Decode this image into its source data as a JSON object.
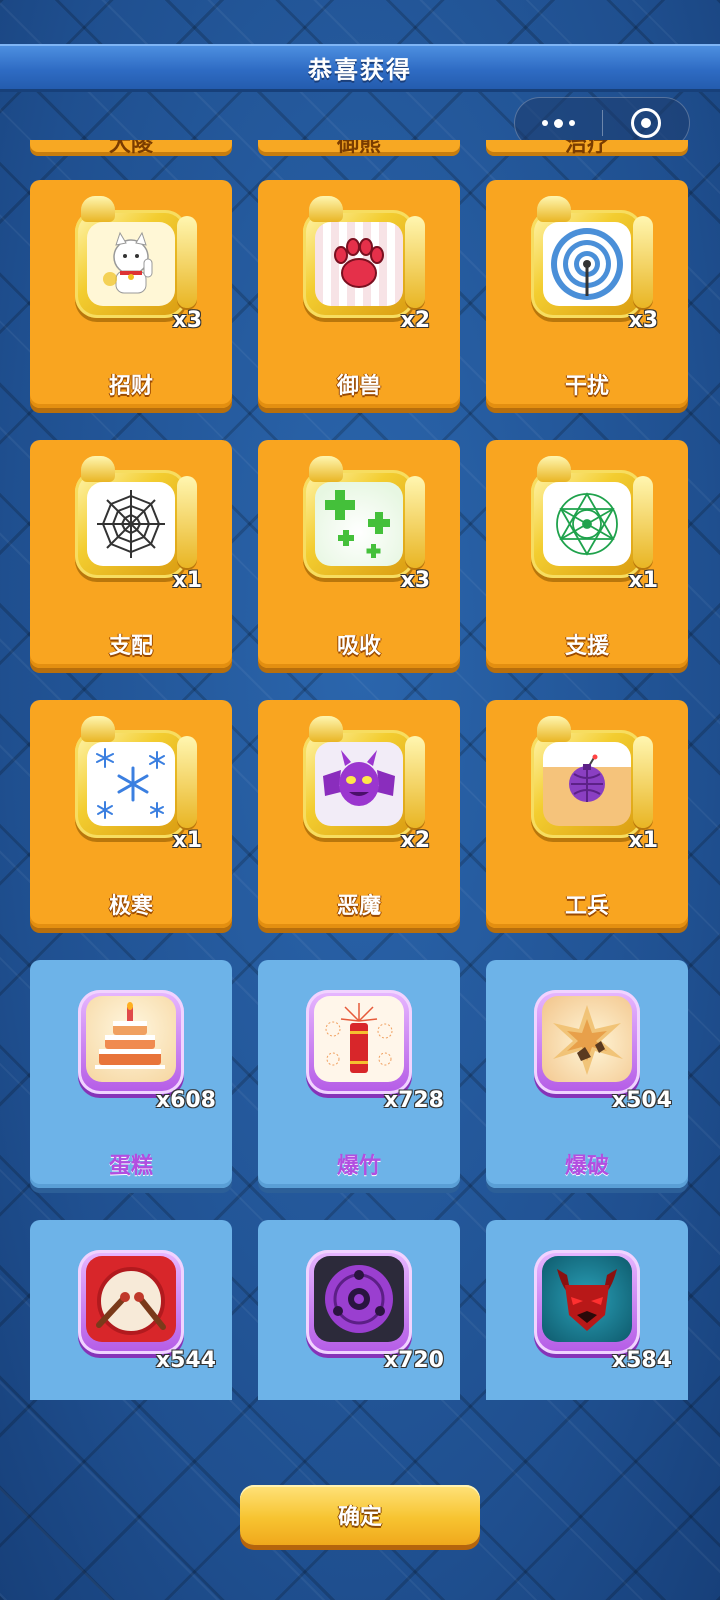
{
  "title": "恭喜获得",
  "partial_row_labels": [
    "大陵",
    "御熊",
    "治疗"
  ],
  "rewards": [
    {
      "name": "招财",
      "count": "x3",
      "icon": "lucky-cat-icon",
      "rarity": "gold"
    },
    {
      "name": "御兽",
      "count": "x2",
      "icon": "paw-icon",
      "rarity": "gold"
    },
    {
      "name": "干扰",
      "count": "x3",
      "icon": "signal-antenna-icon",
      "rarity": "gold"
    },
    {
      "name": "支配",
      "count": "x1",
      "icon": "spider-web-icon",
      "rarity": "gold"
    },
    {
      "name": "吸收",
      "count": "x3",
      "icon": "green-plus-icon",
      "rarity": "gold"
    },
    {
      "name": "支援",
      "count": "x1",
      "icon": "magic-circle-icon",
      "rarity": "gold"
    },
    {
      "name": "极寒",
      "count": "x1",
      "icon": "snowflake-icon",
      "rarity": "gold"
    },
    {
      "name": "恶魔",
      "count": "x2",
      "icon": "demon-bat-icon",
      "rarity": "gold"
    },
    {
      "name": "工兵",
      "count": "x1",
      "icon": "bomb-icon",
      "rarity": "gold"
    },
    {
      "name": "蛋糕",
      "count": "x608",
      "icon": "cake-icon",
      "rarity": "purple"
    },
    {
      "name": "爆竹",
      "count": "x728",
      "icon": "firecracker-icon",
      "rarity": "purple"
    },
    {
      "name": "爆破",
      "count": "x504",
      "icon": "explosion-icon",
      "rarity": "purple"
    },
    {
      "name": "",
      "count": "x544",
      "icon": "drum-icon",
      "rarity": "purple"
    },
    {
      "name": "",
      "count": "x720",
      "icon": "sharingan-icon",
      "rarity": "purple"
    },
    {
      "name": "",
      "count": "x584",
      "icon": "demon-mask-icon",
      "rarity": "purple"
    }
  ],
  "confirm_label": "确定",
  "colors": {
    "gold_card": "#f9a520",
    "blue_card": "#6db3e8",
    "purple_label": "#b24ee0",
    "background": "#1f4f8f"
  }
}
